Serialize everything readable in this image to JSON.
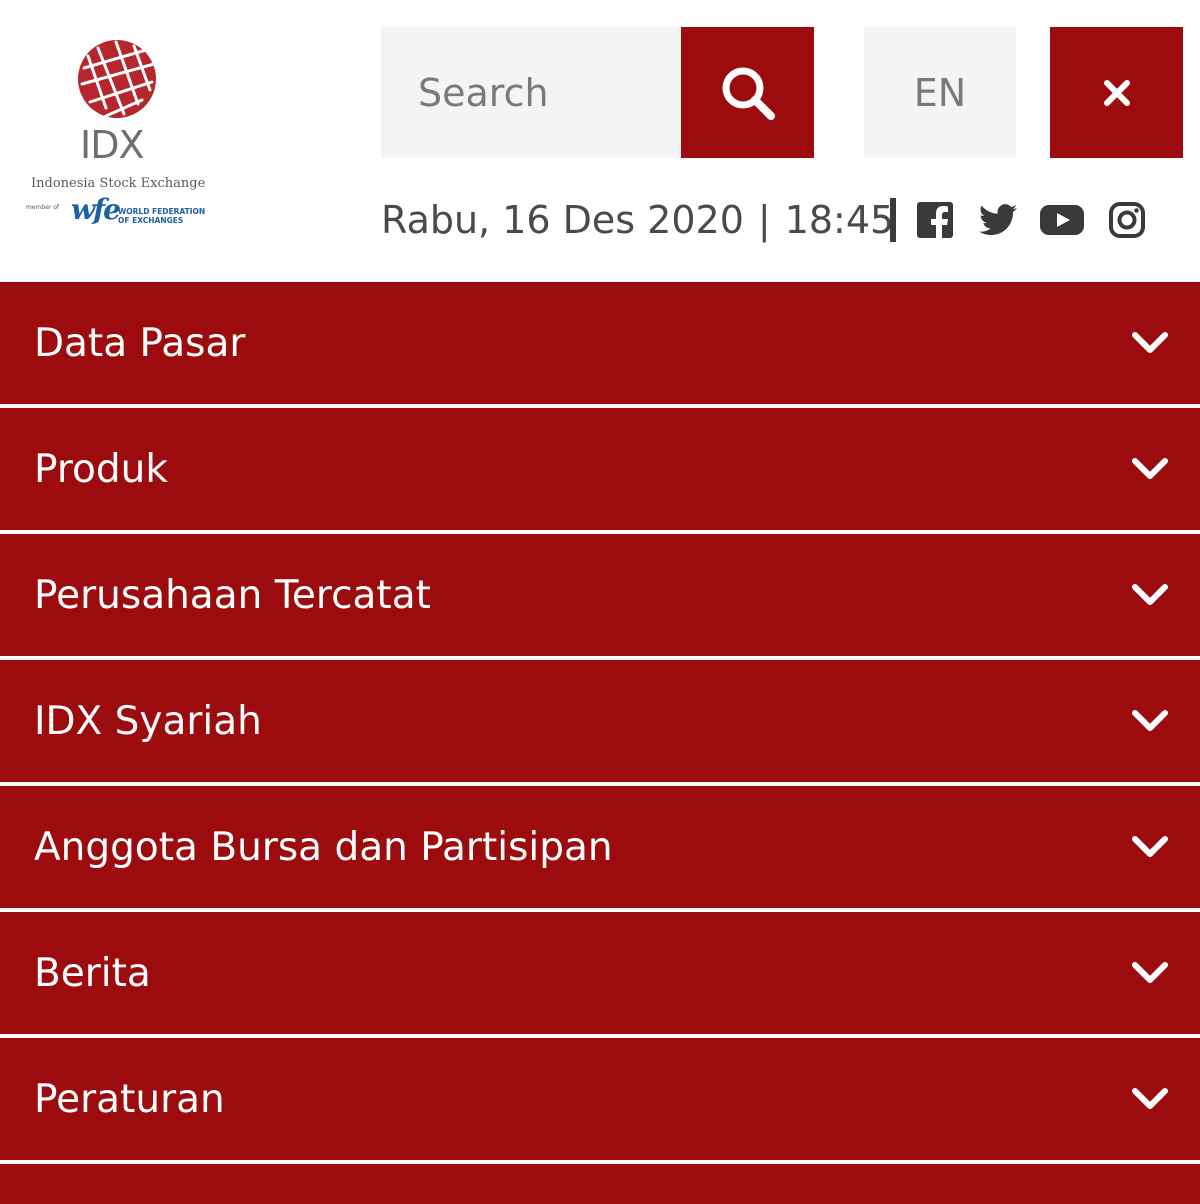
{
  "logo": {
    "name": "IDX",
    "subtitle": "Indonesia Stock Exchange",
    "member_text": "member of",
    "wfe_mark": "wfe",
    "wfe_line1": "WORLD FEDERATION",
    "wfe_line2": "OF EXCHANGES"
  },
  "search": {
    "placeholder": "Search"
  },
  "language": {
    "label": "EN"
  },
  "datetime": {
    "date": "Rabu, 16 Des 2020",
    "time": "18:45"
  },
  "social": [
    "facebook-icon",
    "twitter-icon",
    "youtube-icon",
    "instagram-icon"
  ],
  "menu": {
    "items": [
      {
        "label": "Data Pasar"
      },
      {
        "label": "Produk"
      },
      {
        "label": "Perusahaan Tercatat"
      },
      {
        "label": "IDX Syariah"
      },
      {
        "label": "Anggota Bursa dan Partisipan"
      },
      {
        "label": "Berita"
      },
      {
        "label": "Peraturan"
      }
    ]
  },
  "colors": {
    "brand_red": "#9c0c0e",
    "light_gray": "#f4f4f4",
    "text_gray": "#4a4a4a"
  }
}
